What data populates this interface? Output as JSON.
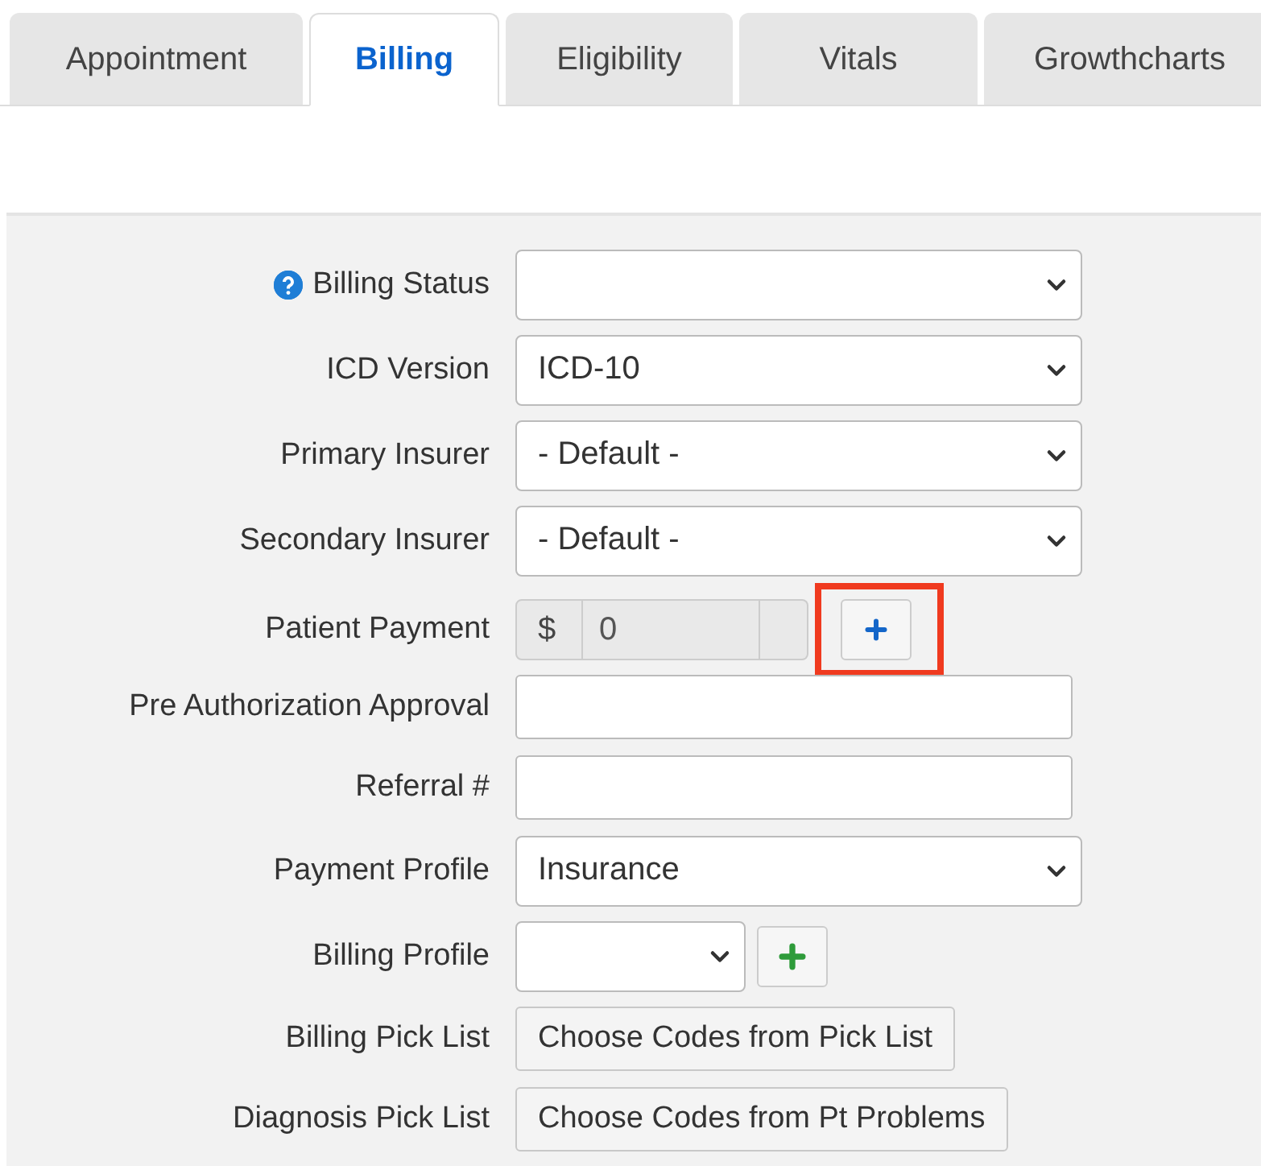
{
  "tabs": [
    {
      "label": "Appointment",
      "selected": false
    },
    {
      "label": "Billing",
      "selected": true
    },
    {
      "label": "Eligibility",
      "selected": false
    },
    {
      "label": "Vitals",
      "selected": false
    },
    {
      "label": "Growthcharts",
      "selected": false
    }
  ],
  "form": {
    "rows": [
      {
        "kind": "select",
        "label": "Billing Status",
        "help": true
      },
      {
        "kind": "select",
        "label": "ICD Version",
        "value": "ICD-10"
      },
      {
        "kind": "select",
        "label": "Primary Insurer",
        "value": "- Default -"
      },
      {
        "kind": "select",
        "label": "Secondary Insurer",
        "value": "- Default -"
      },
      {
        "kind": "money",
        "label": "Patient Payment",
        "prefix": "$",
        "value": "0",
        "add_highlighted": true
      },
      {
        "kind": "text",
        "label": "Pre Authorization Approval"
      },
      {
        "kind": "text",
        "label": "Referral #"
      },
      {
        "kind": "select",
        "label": "Payment Profile",
        "value": "Insurance"
      },
      {
        "kind": "select_add",
        "label": "Billing Profile"
      },
      {
        "kind": "button",
        "label": "Billing Pick List",
        "button": "Choose Codes from Pick List"
      },
      {
        "kind": "button",
        "label": "Diagnosis Pick List",
        "button": "Choose Codes from Pt Problems"
      }
    ]
  }
}
